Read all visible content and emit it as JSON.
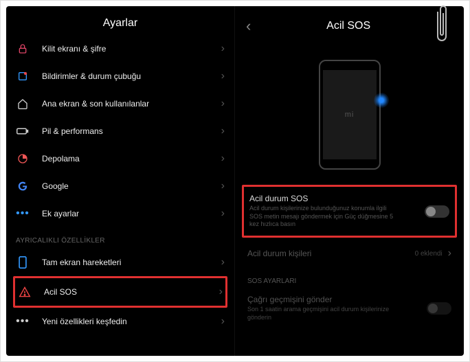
{
  "clip": {
    "present": true
  },
  "left": {
    "title": "Ayarlar",
    "items": [
      {
        "icon": "lock-icon",
        "label": "Kilit ekranı & şifre"
      },
      {
        "icon": "notification-icon",
        "label": "Bildirimler & durum çubuğu"
      },
      {
        "icon": "home-icon",
        "label": "Ana ekran & son kullanılanlar"
      },
      {
        "icon": "battery-icon",
        "label": "Pil & performans"
      },
      {
        "icon": "storage-icon",
        "label": "Depolama"
      },
      {
        "icon": "google-icon",
        "label": "Google"
      },
      {
        "icon": "more-icon",
        "label": "Ek ayarlar"
      }
    ],
    "section_header": "AYRICALIKLI ÖZELLİKLER",
    "priv_items": [
      {
        "icon": "phone-icon",
        "label": "Tam ekran hareketleri"
      },
      {
        "icon": "alert-icon",
        "label": "Acil SOS",
        "highlighted": true
      },
      {
        "icon": "more-icon",
        "label": "Yeni özellikleri keşfedin"
      }
    ]
  },
  "right": {
    "title": "Acil SOS",
    "phone_logo": "mi",
    "sos": {
      "title": "Acil durum SOS",
      "desc": "Acil durum kişilerinize bulunduğunuz konumla ilgili SOS metin mesajı göndermek için Güç düğmesine 5 kez hızlıca basın",
      "enabled": false,
      "highlighted": true
    },
    "contacts": {
      "label": "Acil durum kişileri",
      "value": "0 eklendi"
    },
    "section_header": "SOS AYARLARI",
    "call_history": {
      "title": "Çağrı geçmişini gönder",
      "desc": "Son 1 saatin arama geçmişini acil durum kişilerinize gönderin",
      "enabled": false
    }
  }
}
